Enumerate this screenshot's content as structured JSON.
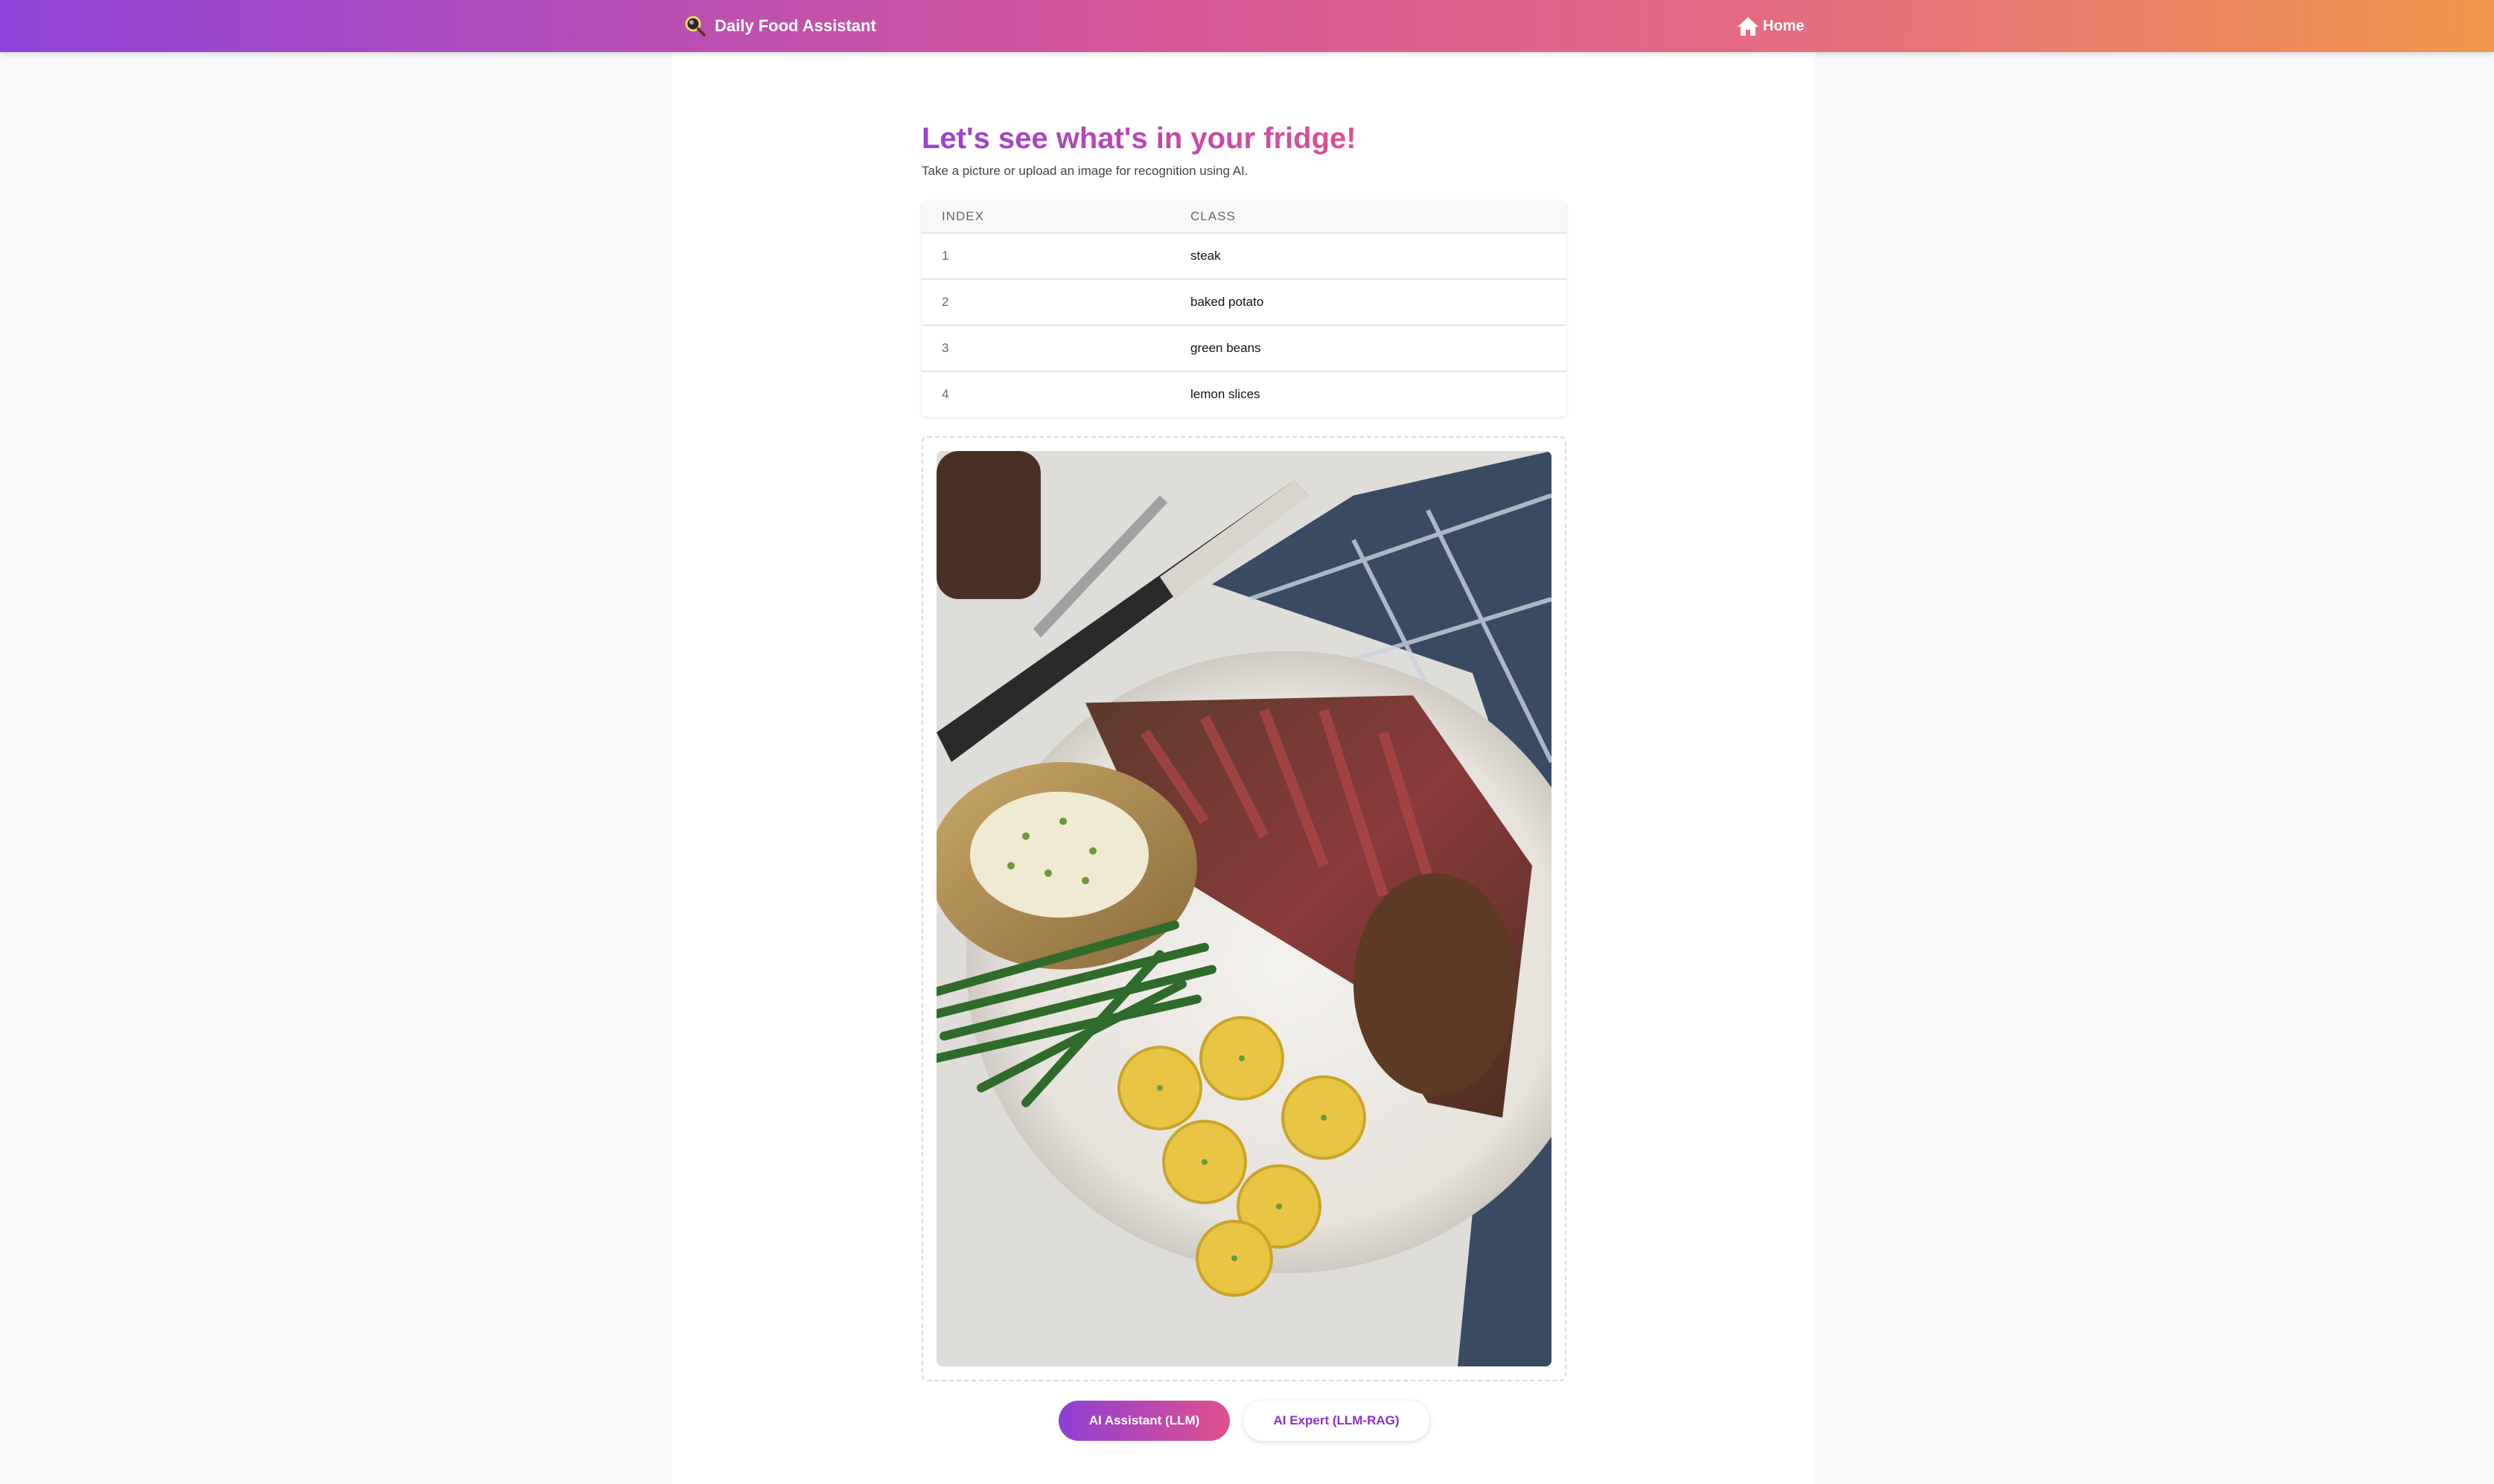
{
  "app": {
    "title": "Daily Food Assistant",
    "brand_icon": "magnifier-icon"
  },
  "nav": {
    "home_label": "Home",
    "home_icon": "house-icon"
  },
  "page": {
    "heading": "Let's see what's in your fridge!",
    "subtitle": "Take a picture or upload an image for recognition using AI."
  },
  "table": {
    "columns": [
      "INDEX",
      "CLASS"
    ],
    "rows": [
      {
        "index": "1",
        "class": "steak"
      },
      {
        "index": "2",
        "class": "baked potato"
      },
      {
        "index": "3",
        "class": "green beans"
      },
      {
        "index": "4",
        "class": "lemon slices"
      }
    ]
  },
  "image": {
    "description_icon": "food-photo"
  },
  "actions": {
    "primary_label": "AI Assistant (LLM)",
    "secondary_label": "AI Expert (LLM-RAG)"
  },
  "colors": {
    "gradient_start": "#8e44d8",
    "gradient_mid": "#d6569a",
    "gradient_end": "#f0964a",
    "accent_purple": "#8a2fd0"
  }
}
